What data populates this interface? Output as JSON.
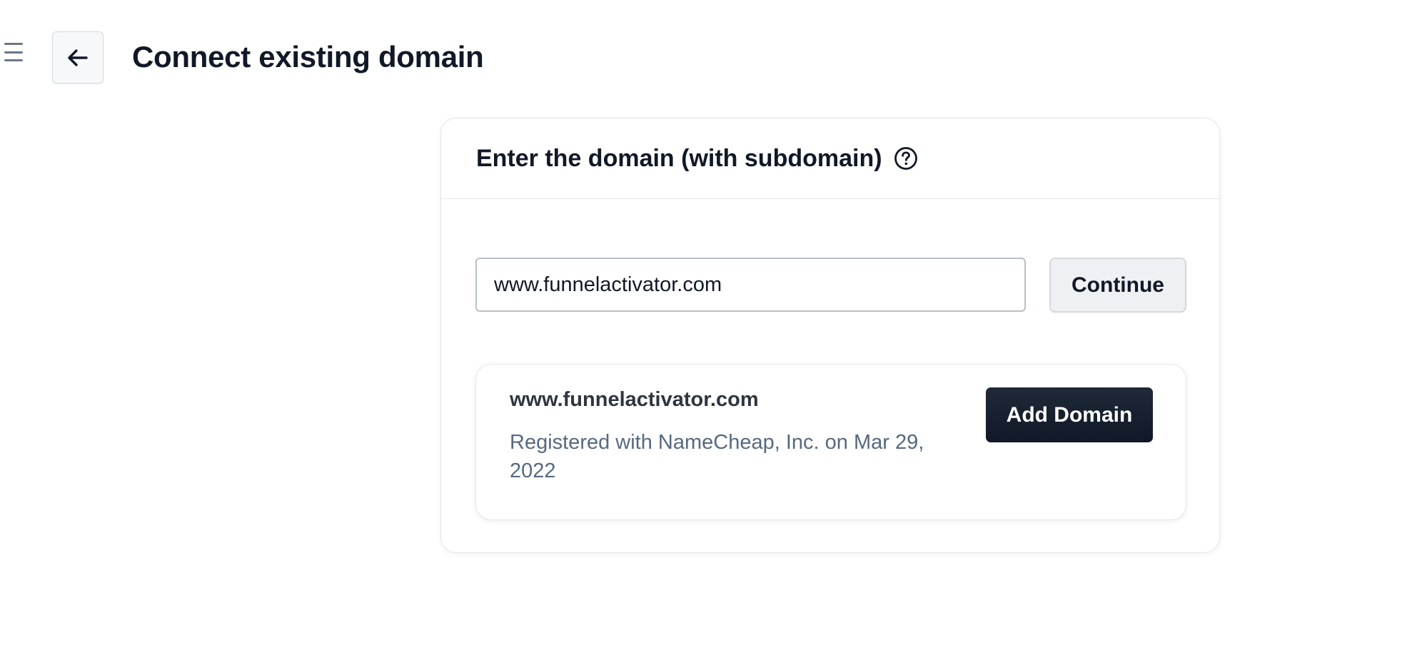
{
  "header": {
    "title": "Connect existing domain",
    "menu_icon": "hamburger-menu-icon",
    "back_icon": "arrow-left-icon"
  },
  "card": {
    "title": "Enter the domain (with subdomain)",
    "help_icon": "question-circle-icon",
    "input_value": "www.funnelactivator.com",
    "continue_label": "Continue"
  },
  "result": {
    "domain": "www.funnelactivator.com",
    "meta": "Registered with NameCheap, Inc. on Mar 29, 2022",
    "add_label": "Add Domain"
  },
  "colors": {
    "primary_button": "#111827",
    "muted_text": "#56697f",
    "border": "#e5e7eb"
  }
}
